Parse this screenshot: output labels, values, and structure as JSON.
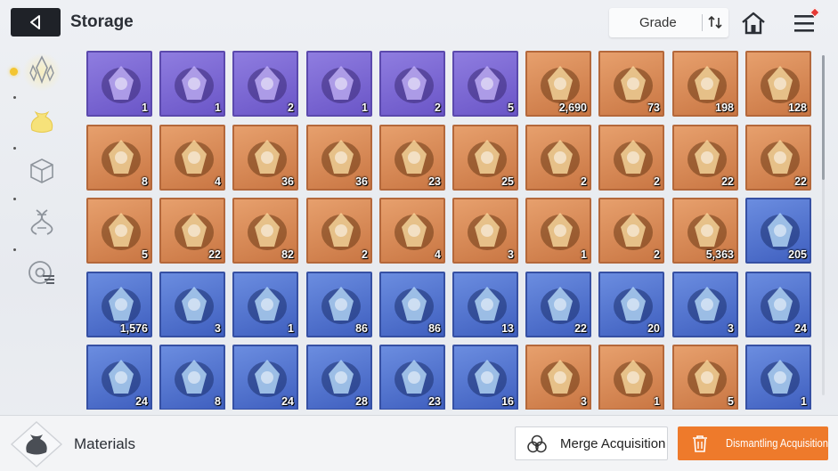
{
  "header": {
    "title": "Storage",
    "grade_label": "Grade",
    "back_icon": "back-arrow-icon",
    "sort_icon": "sort-icon",
    "home_icon": "home-icon",
    "menu_icon": "hamburger-menu-icon",
    "notification_color": "#e53935"
  },
  "sidebar": {
    "items": [
      {
        "icon": "crystal-icon",
        "active": false
      },
      {
        "icon": "pouch-icon",
        "active": true
      },
      {
        "icon": "cube-icon",
        "active": false
      },
      {
        "icon": "dna-icon",
        "active": false
      },
      {
        "icon": "disc-icon",
        "active": false
      }
    ],
    "active_color": "#f3c531"
  },
  "grid": {
    "rows": [
      [
        {
          "rarity": "purple",
          "count": "1",
          "icon": "tarot-card-icon"
        },
        {
          "rarity": "purple",
          "count": "1",
          "icon": "blueprint-icon"
        },
        {
          "rarity": "purple",
          "count": "2",
          "icon": "metal-shell-icon"
        },
        {
          "rarity": "purple",
          "count": "1",
          "icon": "skull-ore-icon"
        },
        {
          "rarity": "purple",
          "count": "2",
          "icon": "flesh-ore-icon"
        },
        {
          "rarity": "purple",
          "count": "5",
          "icon": "red-core-ore-icon"
        },
        {
          "rarity": "orange",
          "count": "2,690",
          "icon": "blue-eye-icon"
        },
        {
          "rarity": "orange",
          "count": "73",
          "icon": "cyan-orb-icon"
        },
        {
          "rarity": "orange",
          "count": "198",
          "icon": "gold-ticket-icon"
        },
        {
          "rarity": "orange",
          "count": "128",
          "icon": "gold-ticket-icon"
        }
      ],
      [
        {
          "rarity": "orange",
          "count": "8",
          "icon": "purple-eye-icon"
        },
        {
          "rarity": "orange",
          "count": "4",
          "icon": "golden-feather-icon"
        },
        {
          "rarity": "orange",
          "count": "36",
          "icon": "purple-crystal-icon"
        },
        {
          "rarity": "orange",
          "count": "36",
          "icon": "green-crystal-icon"
        },
        {
          "rarity": "orange",
          "count": "23",
          "icon": "sword-book-icon"
        },
        {
          "rarity": "orange",
          "count": "25",
          "icon": "shield-book-icon"
        },
        {
          "rarity": "orange",
          "count": "2",
          "icon": "sword-book-icon"
        },
        {
          "rarity": "orange",
          "count": "2",
          "icon": "sword-book-icon"
        },
        {
          "rarity": "orange",
          "count": "22",
          "icon": "sword-medal-icon"
        },
        {
          "rarity": "orange",
          "count": "22",
          "icon": "shield-medal-icon"
        }
      ],
      [
        {
          "rarity": "orange",
          "count": "5",
          "icon": "cross-medal-icon"
        },
        {
          "rarity": "orange",
          "count": "22",
          "icon": "compass-medal-icon"
        },
        {
          "rarity": "orange",
          "count": "82",
          "icon": "sparkle-shards-icon"
        },
        {
          "rarity": "orange",
          "count": "2",
          "icon": "sneakers-icon"
        },
        {
          "rarity": "orange",
          "count": "4",
          "icon": "star-book-icon"
        },
        {
          "rarity": "orange",
          "count": "3",
          "icon": "spray-gun-icon"
        },
        {
          "rarity": "orange",
          "count": "1",
          "icon": "letter-icon"
        },
        {
          "rarity": "orange",
          "count": "2",
          "icon": "dreamcatcher-icon"
        },
        {
          "rarity": "orange",
          "count": "5,363",
          "icon": "music-ticket-icon"
        },
        {
          "rarity": "blue",
          "count": "205",
          "icon": "blue-ticket-icon"
        }
      ],
      [
        {
          "rarity": "blue",
          "count": "1,576",
          "icon": "blue-ticket-icon"
        },
        {
          "rarity": "blue",
          "count": "3",
          "icon": "red-crystal-icon"
        },
        {
          "rarity": "blue",
          "count": "1",
          "icon": "orange-crystal-icon"
        },
        {
          "rarity": "blue",
          "count": "86",
          "icon": "violet-crystal-icon"
        },
        {
          "rarity": "blue",
          "count": "86",
          "icon": "green-crystal-icon"
        },
        {
          "rarity": "blue",
          "count": "13",
          "icon": "ice-crystal-icon"
        },
        {
          "rarity": "blue",
          "count": "22",
          "icon": "sword-book-icon"
        },
        {
          "rarity": "blue",
          "count": "20",
          "icon": "shield-book-icon"
        },
        {
          "rarity": "blue",
          "count": "3",
          "icon": "target-book-icon"
        },
        {
          "rarity": "blue",
          "count": "24",
          "icon": "cross-medal-icon"
        }
      ],
      [
        {
          "rarity": "blue",
          "count": "24",
          "icon": "cross-medal-icon"
        },
        {
          "rarity": "blue",
          "count": "8",
          "icon": "eye-medal-icon"
        },
        {
          "rarity": "blue",
          "count": "24",
          "icon": "bolt-medal-icon"
        },
        {
          "rarity": "blue",
          "count": "28",
          "icon": "target-medal-icon"
        },
        {
          "rarity": "blue",
          "count": "23",
          "icon": "blue-flame-crystal-icon"
        },
        {
          "rarity": "blue",
          "count": "16",
          "icon": "cake-icon"
        },
        {
          "rarity": "orange",
          "count": "3",
          "icon": "pocket-watch-icon"
        },
        {
          "rarity": "orange",
          "count": "1",
          "icon": "star-badge-icon"
        },
        {
          "rarity": "orange",
          "count": "5",
          "icon": "scroll-map-icon"
        },
        {
          "rarity": "blue",
          "count": "1",
          "icon": "dark-helmet-icon"
        }
      ]
    ]
  },
  "footer": {
    "category_label": "Materials",
    "category_icon": "pouch-icon",
    "merge_label": "Merge Acquisition",
    "merge_icon": "merge-circles-icon",
    "dismantle_label": "Dismantling Acquisition",
    "dismantle_icon": "trash-icon",
    "dismantle_color": "#ee7a2b"
  }
}
